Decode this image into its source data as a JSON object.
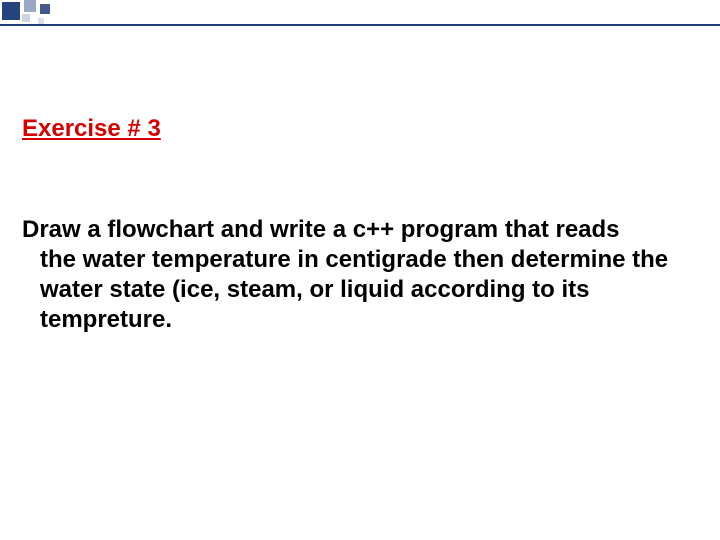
{
  "slide": {
    "title": "Exercise # 3",
    "body_line1": "Draw a flowchart and write a c++ program that reads",
    "body_rest": "the water temperature in centigrade then determine the water state (ice, steam, or liquid according to its tempreture."
  }
}
